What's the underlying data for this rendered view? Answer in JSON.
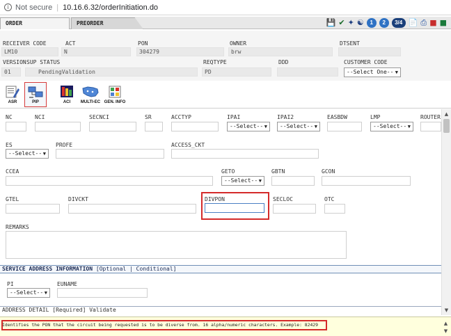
{
  "browser": {
    "security_label": "Not secure",
    "url": "10.16.6.32/orderInitiation.do"
  },
  "tabs": [
    {
      "label": "ORDER",
      "active": true
    },
    {
      "label": "PREORDER",
      "active": false
    }
  ],
  "toolbar": {
    "page_buttons": [
      "1",
      "2",
      "3/4"
    ]
  },
  "header": {
    "receiver_code": {
      "label": "RECEIVER CODE",
      "value": "LM10"
    },
    "act": {
      "label": "ACT",
      "value": "N"
    },
    "pon": {
      "label": "PON",
      "value": "304279"
    },
    "owner": {
      "label": "OWNER",
      "value": "brw"
    },
    "dtsent": {
      "label": "DTSENT",
      "value": ""
    },
    "version": {
      "label": "VERSION",
      "value": "01"
    },
    "sup_status": {
      "label": "SUP STATUS",
      "value": "PendingValidation"
    },
    "reqtype": {
      "label": "REQTYPE",
      "value": "PD"
    },
    "ddd": {
      "label": "DDD",
      "value": ""
    },
    "customer_code": {
      "label": "CUSTOMER CODE",
      "value": "--Select One--"
    }
  },
  "icon_buttons": [
    {
      "label": "ASR",
      "active": false
    },
    {
      "label": "PIP",
      "active": true
    },
    {
      "label": "ACI",
      "active": false
    },
    {
      "label": "MULTI-EC",
      "active": false
    },
    {
      "label": "GEN. INFO",
      "active": false
    }
  ],
  "form": {
    "nc": "NC",
    "nci": "NCI",
    "secnci": "SECNCI",
    "sr": "SR",
    "acctyp": "ACCTYP",
    "ipai": "IPAI",
    "ipai2": "IPAI2",
    "easbdw": "EASBDW",
    "lmp": "LMP",
    "router": "ROUTER",
    "select_short": "--Select--",
    "es": "ES",
    "profe": "PROFE",
    "access_ckt": "ACCESS_CKT",
    "ccea": "CCEA",
    "geto": "GETO",
    "gbtn": "GBTN",
    "gcon": "GCON",
    "gtel": "GTEL",
    "divckt": "DIVCKT",
    "divpon": "DIVPON",
    "secloc": "SECLOC",
    "otc": "OTC",
    "remarks": "REMARKS"
  },
  "service_address": {
    "title": "SERVICE ADDRESS INFORMATION",
    "qualifier": "[Optional | Conditional]",
    "pi_label": "PI",
    "pi_value": "--Select--",
    "euname_label": "EUNAME",
    "address_detail": "ADDRESS DETAIL [Required] Validate"
  },
  "status_bar": {
    "message": "Identifies the PON that the circuit being requested is to be diverse from. 16 alpha/numeric characters. Example: 82429"
  },
  "colors": {
    "highlight": "#d42a2a",
    "section_text": "#1a2a55",
    "status_bg": "#ffffdd",
    "readonly_bg": "#e9e9e9"
  }
}
